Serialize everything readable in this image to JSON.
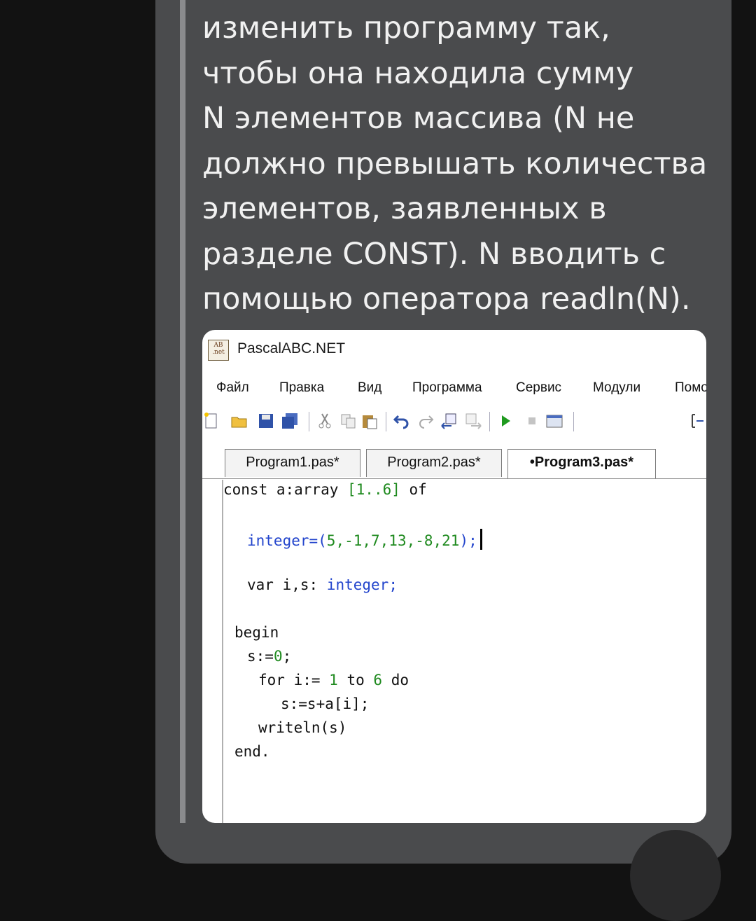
{
  "message": {
    "lines": [
      "изменить программу так,",
      "чтобы она находила сумму",
      "N элементов массива (N не",
      "должно превышать количества",
      "элементов, заявленных в",
      "разделе CONST). N вводить с",
      "помощью оператора readln(N)."
    ]
  },
  "app": {
    "title": "PascalABC.NET",
    "icon_top": "AB",
    "icon_bottom": ".net",
    "menu": [
      "Файл",
      "Правка",
      "Вид",
      "Программа",
      "Сервис",
      "Модули",
      "Помо"
    ],
    "toolbar_icons": [
      "new-file-icon",
      "open-folder-icon",
      "save-icon",
      "save-all-icon",
      "cut-icon",
      "copy-icon",
      "paste-icon",
      "undo-icon",
      "redo-icon",
      "navigate-back-icon",
      "navigate-forward-icon",
      "run-icon",
      "stop-icon",
      "form-designer-icon",
      "refresh-icon"
    ],
    "tabs": [
      "Program1.pas*",
      "Program2.pas*",
      "•Program3.pas*"
    ],
    "active_tab": 2,
    "code": {
      "l1": {
        "a": "const a:array ",
        "b": "[1..6]",
        "c": " of"
      },
      "l2": {
        "a": "integer=(",
        "b": "5,-1,7,13,-8,21",
        "c": ");"
      },
      "l3": {
        "a": "var i,s: ",
        "b": "integer",
        "c": ";"
      },
      "l4": "begin",
      "l5": {
        "a": "s:=",
        "b": "0",
        "c": ";"
      },
      "l6": {
        "a": "for i:= ",
        "b": "1",
        "c": " to ",
        "d": "6",
        "e": " do"
      },
      "l7": "s:=s+a[i];",
      "l8": "writeln(s)",
      "l9": "end."
    }
  },
  "colors": {
    "type_keyword": "#2244cc",
    "number_literal": "#1f8a1f",
    "card_background": "#4a4b4d"
  }
}
